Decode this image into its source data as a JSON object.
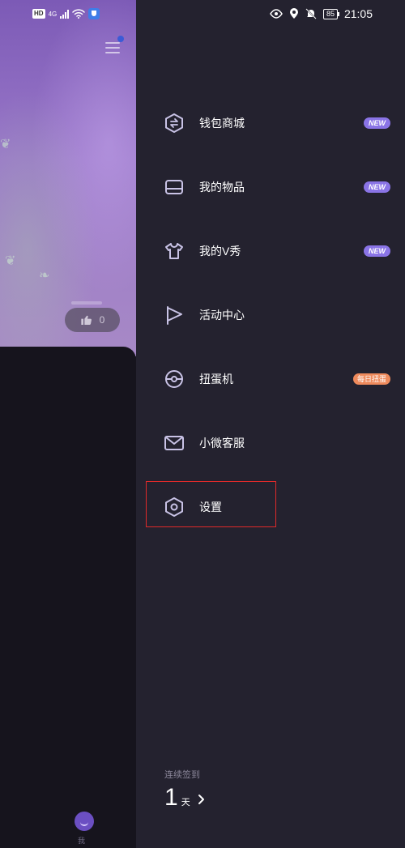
{
  "status_bar": {
    "hd": "HD",
    "network": "4G",
    "battery": "85",
    "time": "21:05"
  },
  "background_page": {
    "like_count": "0",
    "me_label": "我"
  },
  "drawer": {
    "items": [
      {
        "label": "钱包商城",
        "icon": "wallet-hexagon-icon",
        "badge": "NEW"
      },
      {
        "label": "我的物品",
        "icon": "box-icon",
        "badge": "NEW"
      },
      {
        "label": "我的V秀",
        "icon": "tshirt-icon",
        "badge": "NEW"
      },
      {
        "label": "活动中心",
        "icon": "flag-icon",
        "badge": ""
      },
      {
        "label": "扭蛋机",
        "icon": "gacha-icon",
        "badge": "每日扭蛋"
      },
      {
        "label": "小微客服",
        "icon": "mail-icon",
        "badge": ""
      },
      {
        "label": "设置",
        "icon": "gear-icon",
        "badge": ""
      }
    ],
    "checkin": {
      "label": "连续签到",
      "days": "1",
      "unit": "天"
    }
  },
  "colors": {
    "drawer_bg": "#24222f",
    "icon_stroke": "#c9c3e6",
    "badge_new": "#8a74e6",
    "badge_daily": "#ee8a5c",
    "highlight": "#e02a2a"
  }
}
